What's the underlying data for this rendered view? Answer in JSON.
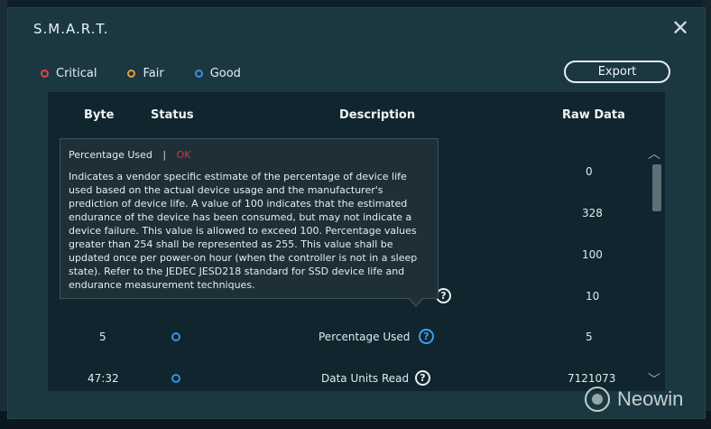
{
  "dialog": {
    "title": "S.M.A.R.T.",
    "close_label": "✕"
  },
  "legend": {
    "items": [
      {
        "label": "Critical",
        "color": "#d9474e"
      },
      {
        "label": "Fair",
        "color": "#e3a13b"
      },
      {
        "label": "Good",
        "color": "#3a8fe6"
      }
    ]
  },
  "toolbar": {
    "export_label": "Export"
  },
  "table": {
    "headers": {
      "byte": "Byte",
      "status": "Status",
      "description": "Description",
      "raw_data": "Raw Data"
    },
    "hidden_raw": [
      "0",
      "328",
      "100",
      "10"
    ],
    "rows": [
      {
        "byte": "5",
        "description": "Percentage Used",
        "raw": "5"
      },
      {
        "byte": "47:32",
        "description": "Data Units Read",
        "raw": "7121073"
      }
    ],
    "help_glyph": "?"
  },
  "tooltip": {
    "title": "Percentage Used",
    "separator": "|",
    "status": "OK",
    "body": "Indicates a vendor specific estimate of the percentage of device life used based on the actual device usage and the manufacturer's prediction of device life. A value of 100 indicates that the estimated endurance of the device has been consumed, but may not indicate a device failure. This value is allowed to exceed 100. Percentage values greater than 254 shall be represented as 255. This value shall be updated once per power-on hour (when the controller is not in a sleep state). Refer to the JEDEC JESD218 standard for SSD device life and endurance measurement techniques."
  },
  "scroll": {
    "up": "︿",
    "down": "﹀"
  },
  "watermark": {
    "text": "Neowin"
  }
}
